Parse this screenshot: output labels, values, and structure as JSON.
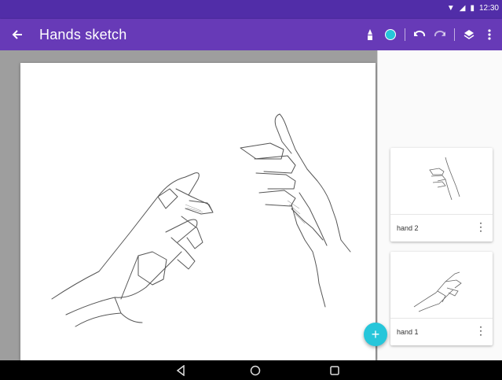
{
  "status_bar": {
    "time": "12:30"
  },
  "app_bar": {
    "title": "Hands sketch",
    "icons": [
      "back-arrow-icon",
      "brush-icon",
      "color-swatch",
      "undo-icon",
      "redo-icon",
      "layers-icon",
      "overflow-menu-icon"
    ],
    "accent_color": "#673ab7",
    "status_color": "#512da8",
    "swatch_color": "#26c6da"
  },
  "layers": [
    {
      "name": "hand 2"
    },
    {
      "name": "hand 1"
    }
  ],
  "fab": {
    "label": "+"
  },
  "nav_bar": {
    "buttons": [
      "back-triangle",
      "home-circle",
      "recents-square"
    ]
  }
}
